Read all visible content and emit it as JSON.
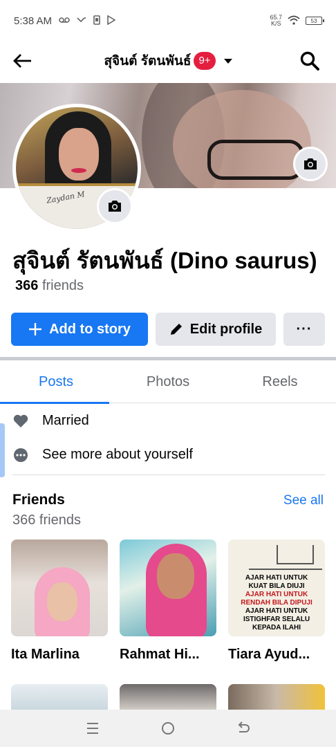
{
  "status_bar": {
    "time": "5:38 AM",
    "net_speed_value": "65.7",
    "net_speed_unit": "K/S",
    "battery": "53"
  },
  "header": {
    "title": "สุจินต์ รัตนพันธ์",
    "badge": "9+"
  },
  "profile": {
    "name": "สุจินต์ รัตนพันธ์ (Dino saurus)",
    "friends_count": "366",
    "friends_label": "friends",
    "avatar_frame_text": "Zaydan M"
  },
  "actions": {
    "add_story": "Add to story",
    "edit_profile": "Edit profile",
    "more": "···"
  },
  "tabs": [
    {
      "label": "Posts",
      "active": true
    },
    {
      "label": "Photos",
      "active": false
    },
    {
      "label": "Reels",
      "active": false
    }
  ],
  "intro": {
    "relationship": "Married",
    "see_more": "See more about yourself"
  },
  "friends_section": {
    "title": "Friends",
    "see_all": "See all",
    "count_text": "366 friends",
    "friends": [
      {
        "name": "Ita Marlina"
      },
      {
        "name": "Rahmat Hi..."
      },
      {
        "name": "Tiara Ayud..."
      }
    ],
    "poster_lines": [
      "AJAR HATI UNTUK",
      "KUAT BILA DIUJI",
      "AJAR HATI UNTUK",
      "RENDAH BILA DIPUJI",
      "AJAR HATI UNTUK",
      "ISTIGHFAR SELALU",
      "KEPADA ILAHI"
    ]
  },
  "colors": {
    "accent": "#1877f2",
    "badge": "#e41e3f",
    "secondary_bg": "#e4e6eb",
    "muted_text": "#65676b"
  }
}
